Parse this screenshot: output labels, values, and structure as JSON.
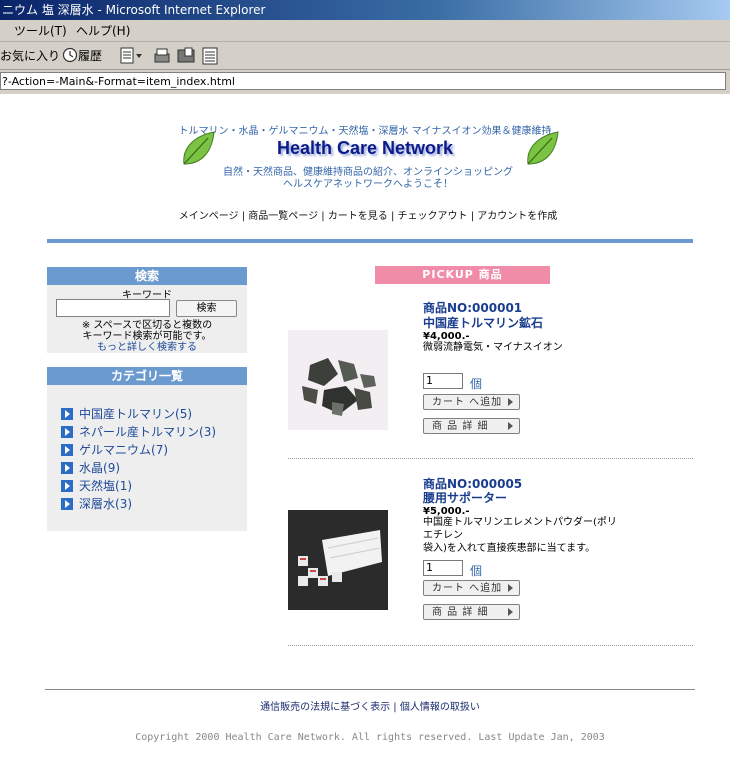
{
  "window": {
    "title": "ニウム 塩 深層水 - Microsoft Internet Explorer"
  },
  "menubar": {
    "tools": "ツール(T)",
    "help": "ヘルプ(H)"
  },
  "toolbar": {
    "favorites": "お気に入り",
    "history": "履歴"
  },
  "address": {
    "url": "?-Action=-Main&-Format=item_index.html"
  },
  "header": {
    "tagline": "トルマリン・水晶・ゲルマニウム・天然塩・深層水 マイナスイオン効果＆健康維持",
    "logo_text": "Health Care Network",
    "sub1": "自然・天然商品、健康維持商品の紹介、オンラインショッピング",
    "sub2": "ヘルスケアネットワークへようこそ！",
    "nav": [
      "メインページ",
      "商品一覧ページ",
      "カートを見る",
      "チェックアウト",
      "アカウントを作成"
    ]
  },
  "search": {
    "title": "検索",
    "keyword_label": "キーワード",
    "input_value": "",
    "button": "検索",
    "note1": "※ スペースで区切ると複数の",
    "note2": "キーワード検索が可能です。",
    "advanced_link": "もっと詳しく検索する"
  },
  "categories": {
    "title": "カテゴリ一覧",
    "items": [
      {
        "name": "中国産トルマリン",
        "count": "(5)"
      },
      {
        "name": "ネパール産トルマリン",
        "count": "(3)"
      },
      {
        "name": "ゲルマニウム",
        "count": "(7)"
      },
      {
        "name": "水晶",
        "count": "(9)"
      },
      {
        "name": "天然塩",
        "count": "(1)"
      },
      {
        "name": "深層水",
        "count": "(3)"
      }
    ]
  },
  "pickup": {
    "title": "PICKUP 商品"
  },
  "products": [
    {
      "no": "商品NO:000001",
      "name": "中国産トルマリン鉱石",
      "price": "¥4,000.-",
      "desc1": "微弱流静電気・マイナスイオン",
      "desc2": "",
      "qty": "1",
      "unit": "個",
      "add_cart": "カート へ追加",
      "detail": "商 品 詳 細"
    },
    {
      "no": "商品NO:000005",
      "name": "腰用サポーター",
      "price": "¥5,000.-",
      "desc1": "中国産トルマリンエレメントパウダー(ポリエチレン",
      "desc2": "袋入)を入れて直接疾患部に当てます。",
      "qty": "1",
      "unit": "個",
      "add_cart": "カート へ追加",
      "detail": "商 品 詳 細"
    }
  ],
  "footer": {
    "links": [
      "通信販売の法規に基づく表示",
      "個人情報の取扱い"
    ],
    "copyright": "Copyright 2000 Health Care Network. All rights reserved. Last Update Jan, 2003"
  },
  "colors": {
    "accent": "#6b9bce",
    "pickup": "#f08ca8",
    "link": "#1e4a99"
  }
}
